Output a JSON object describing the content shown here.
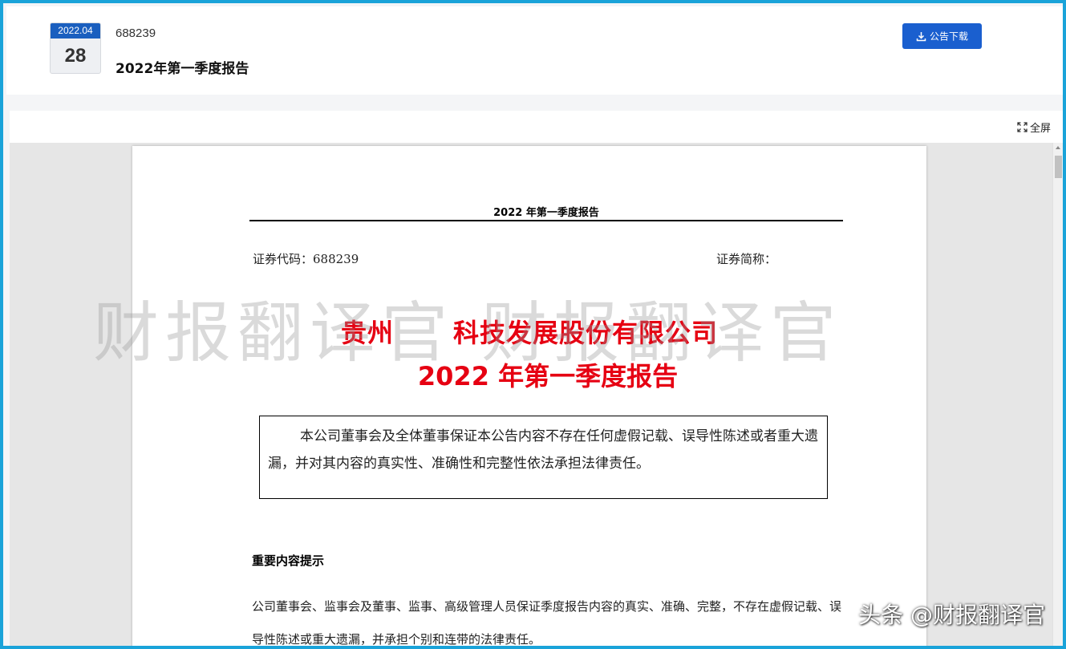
{
  "header": {
    "date": {
      "year_month": "2022.04",
      "day": "28"
    },
    "stock_code": "688239",
    "title": "2022年第一季度报告",
    "download_label": "公告下载"
  },
  "viewer": {
    "fullscreen_label": "全屏"
  },
  "document": {
    "head_title": "2022 年第一季度报告",
    "security_code": "证券代码：688239",
    "security_abbr": "证券简称：",
    "company_part1": "贵州",
    "company_part2": "科技发展股份有限公司",
    "report_title": "2022 年第一季度报告",
    "statement": "本公司董事会及全体董事保证本公告内容不存在任何虚假记载、误导性陈述或者重大遗漏，并对其内容的真实性、准确性和完整性依法承担法律责任。",
    "important_heading": "重要内容提示",
    "important_text": "公司董事会、监事会及董事、监事、高级管理人员保证季度报告内容的真实、准确、完整，不存在虚假记载、误导性陈述或重大遗漏，并承担个别和连带的法律责任。"
  },
  "watermark": "财报翻译官    财报翻译官",
  "corner_watermark": "头条 @财报翻译官",
  "colors": {
    "accent": "#1a5fcf",
    "company_title": "#e60012",
    "frame_border": "#1aa3d9"
  }
}
